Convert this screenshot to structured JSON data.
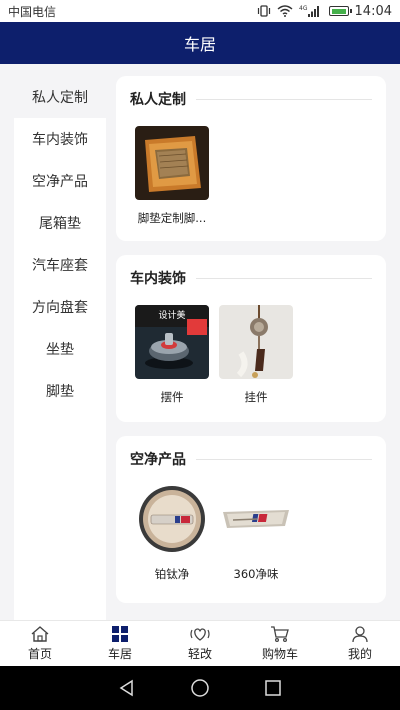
{
  "status_bar": {
    "carrier": "中国电信",
    "time": "14:04",
    "network": "4G"
  },
  "header": {
    "title": "车居"
  },
  "sidebar": {
    "items": [
      {
        "label": "私人定制"
      },
      {
        "label": "车内装饰"
      },
      {
        "label": "空净产品"
      },
      {
        "label": "尾箱垫"
      },
      {
        "label": "汽车座套"
      },
      {
        "label": "方向盘套"
      },
      {
        "label": "坐垫"
      },
      {
        "label": "脚垫"
      }
    ]
  },
  "sections": [
    {
      "title": "私人定制",
      "products": [
        {
          "label": "脚垫定制脚...",
          "icon": "floor-mat-image"
        }
      ]
    },
    {
      "title": "车内装饰",
      "products": [
        {
          "label": "摆件",
          "icon": "dashboard-ornament-image",
          "banner": "设计美"
        },
        {
          "label": "挂件",
          "icon": "hanging-pendant-image"
        }
      ]
    },
    {
      "title": "空净产品",
      "products": [
        {
          "label": "铂钛净",
          "icon": "round-air-purifier-image"
        },
        {
          "label": "360净味",
          "icon": "vent-clip-freshener-image"
        }
      ]
    }
  ],
  "bottom_nav": {
    "items": [
      {
        "label": "首页",
        "icon": "home-icon"
      },
      {
        "label": "车居",
        "icon": "grid-icon"
      },
      {
        "label": "轻改",
        "icon": "heart-icon"
      },
      {
        "label": "购物车",
        "icon": "cart-icon"
      },
      {
        "label": "我的",
        "icon": "user-icon"
      }
    ]
  },
  "colors": {
    "header_bg": "#0d1f6c",
    "active_nav": "#0d1f6c",
    "page_bg": "#f4f4f6"
  }
}
